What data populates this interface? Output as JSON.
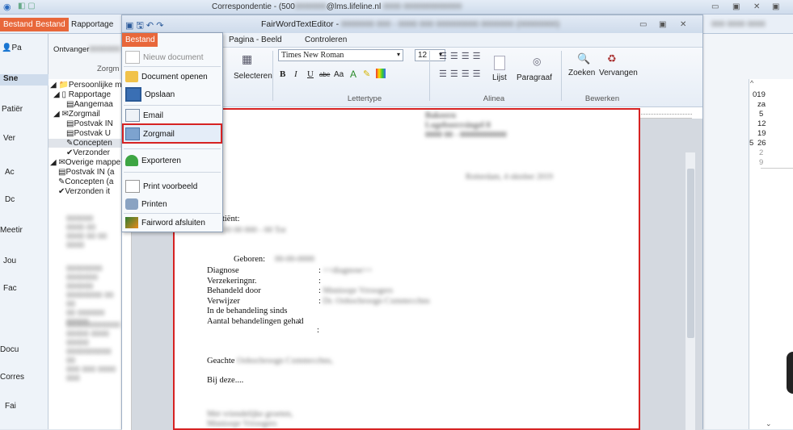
{
  "outer": {
    "title_prefix": "Correspondentie - (500",
    "title_suffix": "@lms.lifeline.nl",
    "tabs": [
      "Bestand",
      "Bestand",
      "Rapportage"
    ],
    "ontvanger_label": "Ontvanger",
    "zorgmail_label": "Zorgm",
    "sne_label": "Sne",
    "sidebar": [
      "Patiër",
      "Ver",
      "Ac",
      "Dc",
      "Meetir",
      "Jou",
      "Fac",
      "Docu",
      "Corres",
      "Fai"
    ],
    "pa_label": "Pa"
  },
  "tree": {
    "items": [
      {
        "label": "Persoonlijke ma",
        "level": 0
      },
      {
        "label": "Rapportage",
        "level": 1
      },
      {
        "label": "Aangemaa",
        "level": 2
      },
      {
        "label": "Zorgmail",
        "level": 1
      },
      {
        "label": "Postvak IN",
        "level": 2
      },
      {
        "label": "Postvak U",
        "level": 2
      },
      {
        "label": "Concepten",
        "level": 2
      },
      {
        "label": "Verzonder",
        "level": 2
      },
      {
        "label": "Overige mappe",
        "level": 0
      },
      {
        "label": "Postvak IN (a",
        "level": 1
      },
      {
        "label": "Concepten (a",
        "level": 1
      },
      {
        "label": "Verzonden it",
        "level": 1
      }
    ]
  },
  "editor": {
    "title": "FairWordTextEditor -",
    "menu": [
      "Pagina - Beeld",
      "Controleren"
    ],
    "ribbon": {
      "select_label": "Selecteren",
      "font_name": "Times New Roman",
      "font_size": "12",
      "format_buttons": [
        "B",
        "I",
        "U",
        "abe",
        "Aa"
      ],
      "lijst": "Lijst",
      "paragraaf": "Paragraaf",
      "zoeken": "Zoeken",
      "vervangen": "Vervangen",
      "group_lettertype": "Lettertype",
      "group_alinea": "Alinea",
      "group_bewerken": "Bewerken"
    }
  },
  "menu": {
    "header": "Bestand",
    "items": [
      {
        "label": "Nieuw document",
        "disabled": true
      },
      {
        "label": "Document openen",
        "disabled": false
      },
      {
        "label": "Opslaan",
        "disabled": false
      },
      {
        "label": "Email",
        "disabled": false
      },
      {
        "label": "Zorgmail",
        "disabled": false
      },
      {
        "label": "Exporteren",
        "disabled": false
      },
      {
        "label": "Print voorbeeld",
        "disabled": false
      },
      {
        "label": "Printen",
        "disabled": false
      },
      {
        "label": "Fairword afsluiten",
        "disabled": false
      }
    ]
  },
  "document": {
    "date_line": "Rotterdam, 4 oktober 2019",
    "betreft": "ft patiënt:",
    "geboren": "Geboren:",
    "fields": [
      "Diagnose",
      "Verzekeringnr.",
      "Behandeld door",
      "Verwijzer",
      "In de behandeling sinds",
      "Aantal behandelingen gehad"
    ],
    "colon": ":",
    "diagnose_value": "<<diagnose>>",
    "geachte": "Geachte",
    "bij_deze": "Bij deze....",
    "greeting": "Met vriendelijke groeten,"
  },
  "calendar": {
    "year_prefix": "019",
    "weekday": "za",
    "days": [
      "5",
      "12",
      "19",
      "26",
      "2",
      "9"
    ],
    "row_prefix": [
      "",
      "",
      "",
      "5",
      "",
      ""
    ]
  },
  "colors": {
    "accent": "#e8673a",
    "highlight": "#d62222"
  }
}
